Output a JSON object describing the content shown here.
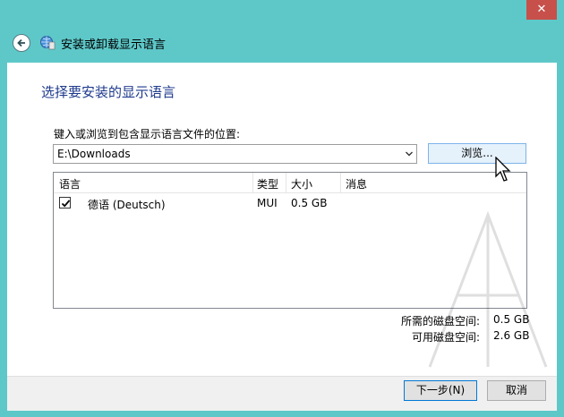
{
  "window": {
    "title": "安装或卸载显示语言",
    "close_label": "✕"
  },
  "main": {
    "heading": "选择要安装的显示语言",
    "path_label": "键入或浏览到包含显示语言文件的位置:",
    "path_value": "E:\\Downloads",
    "browse_label": "浏览..."
  },
  "list": {
    "columns": [
      "语言",
      "类型",
      "大小",
      "消息"
    ],
    "rows": [
      {
        "checked": true,
        "language": "德语 (Deutsch)",
        "type": "MUI",
        "size": "0.5 GB",
        "message": ""
      }
    ]
  },
  "space": {
    "required_label": "所需的磁盘空间:",
    "required_value": "0.5 GB",
    "available_label": "可用磁盘空间:",
    "available_value": "2.6 GB"
  },
  "footer": {
    "next_label": "下一步(N)",
    "cancel_label": "取消"
  },
  "colors": {
    "frame": "#5ec8c9",
    "heading": "#1e3a8c",
    "close": "#c7504b"
  }
}
